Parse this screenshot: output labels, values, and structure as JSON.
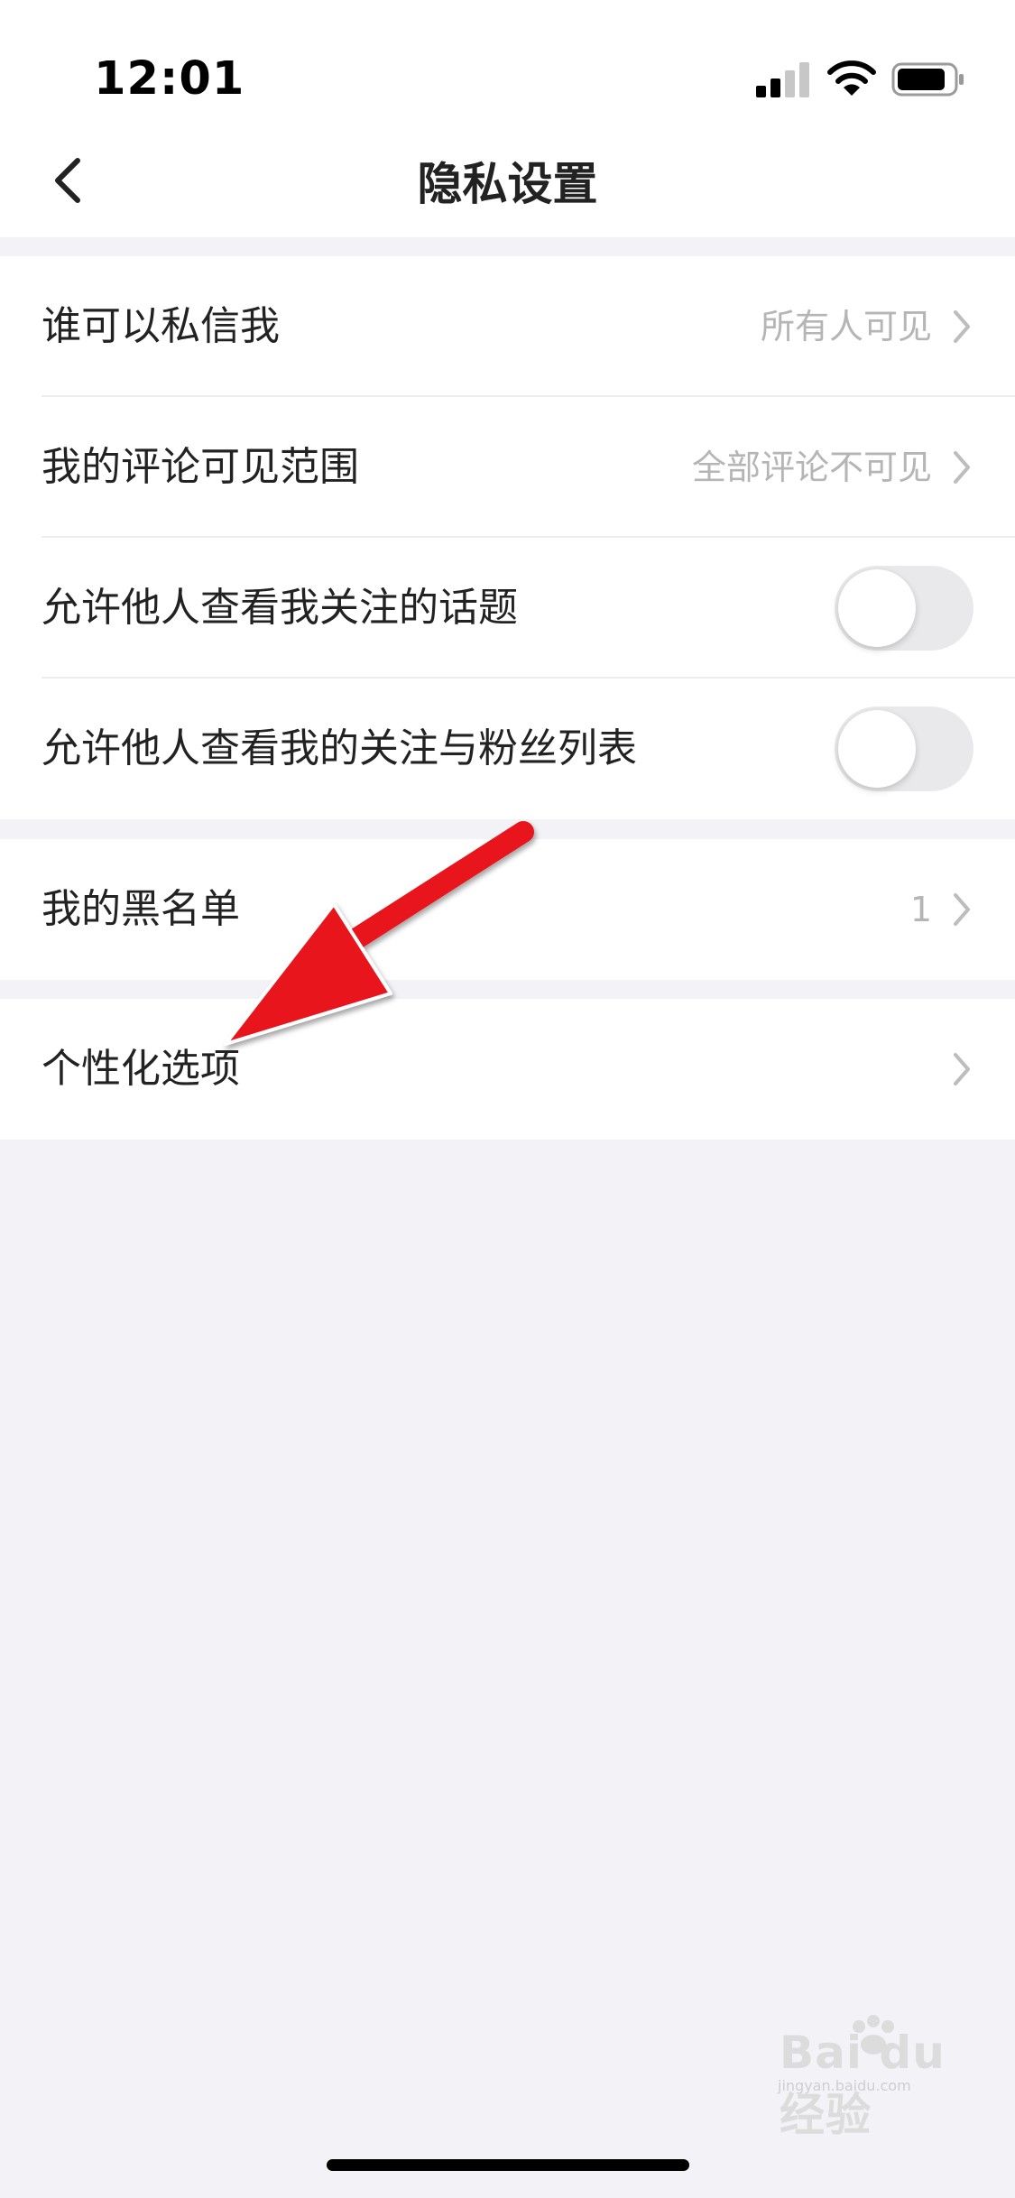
{
  "status_bar": {
    "time": "12:01",
    "signal_icon": "cellular-signal-icon",
    "wifi_icon": "wifi-icon",
    "battery_icon": "battery-icon"
  },
  "nav": {
    "title": "隐私设置",
    "back_icon": "chevron-left-icon"
  },
  "section1": {
    "items": [
      {
        "label": "谁可以私信我",
        "value": "所有人可见",
        "control": "chevron"
      },
      {
        "label": "我的评论可见范围",
        "value": "全部评论不可见",
        "control": "chevron"
      },
      {
        "label": "允许他人查看我关注的话题",
        "control": "toggle",
        "on": false
      },
      {
        "label": "允许他人查看我的关注与粉丝列表",
        "control": "toggle",
        "on": false
      }
    ]
  },
  "section2": {
    "items": [
      {
        "label": "我的黑名单",
        "value": "1",
        "control": "chevron"
      }
    ]
  },
  "section3": {
    "items": [
      {
        "label": "个性化选项",
        "control": "chevron"
      }
    ]
  },
  "annotation": {
    "arrow_color": "#e8141a"
  },
  "watermark": {
    "brand": "Bai du 经验",
    "url": "jingyan.baidu.com"
  },
  "colors": {
    "background": "#f2f2f7",
    "card": "#ffffff",
    "text": "#222222",
    "secondary_text": "#b5b5b5",
    "toggle_off": "#e9e9eb"
  }
}
